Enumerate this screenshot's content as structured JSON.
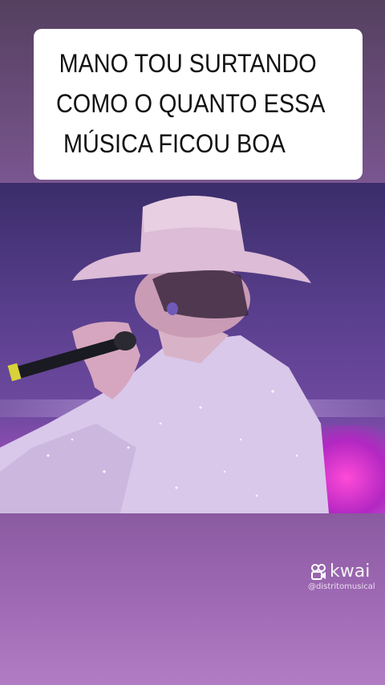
{
  "caption": {
    "lines": [
      "MANO TOU SURTANDO",
      "COMO O QUANTO ESSA",
      "MÚSICA FICOU BOA"
    ]
  },
  "watermark": {
    "brand": "kwai",
    "handle": "@distritomusical",
    "icon": "kwai-logo-icon"
  },
  "video": {
    "subject": "performer in cowboy hat singing into microphone"
  },
  "colors": {
    "background_purple": "#7e5296",
    "caption_bg": "#ffffff",
    "caption_text": "#111111",
    "stage_pink": "#ff4ad8"
  }
}
